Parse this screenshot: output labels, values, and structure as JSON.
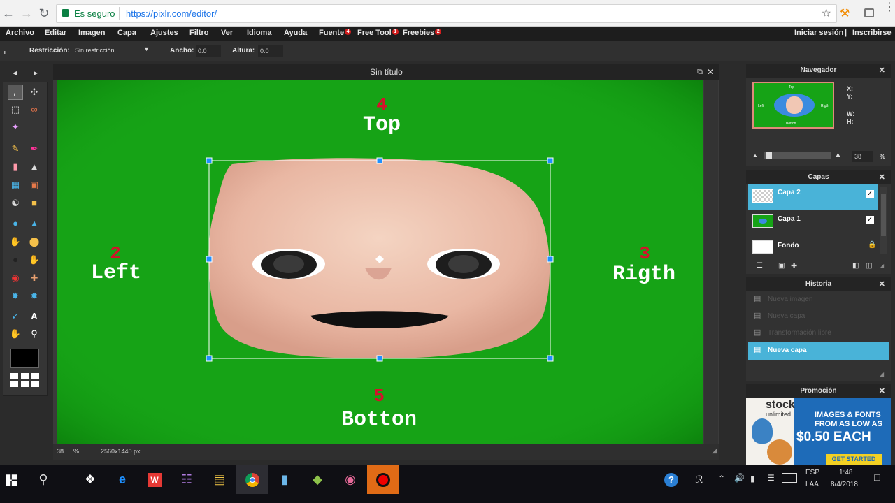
{
  "browser": {
    "secure_label": "Es seguro",
    "url": "https://pixlr.com/editor/"
  },
  "menu": {
    "items": [
      {
        "label": "Archivo"
      },
      {
        "label": "Editar"
      },
      {
        "label": "Imagen"
      },
      {
        "label": "Capa"
      },
      {
        "label": "Ajustes"
      },
      {
        "label": "Filtro"
      },
      {
        "label": "Ver"
      },
      {
        "label": "Idioma"
      },
      {
        "label": "Ayuda"
      },
      {
        "label": "Fuente",
        "badge": "4"
      },
      {
        "label": "Free Tool",
        "badge": "1"
      },
      {
        "label": "Freebies",
        "badge": "2"
      }
    ],
    "login": "Iniciar sesión",
    "separator": "|",
    "signup": "Inscribirse"
  },
  "options": {
    "restriction_label": "Restricción:",
    "restriction_value": "Sin restricción",
    "width_label": "Ancho:",
    "width_value": "0.0",
    "height_label": "Altura:",
    "height_value": "0.0"
  },
  "document": {
    "title": "Sin título",
    "zoom": "38",
    "zoom_unit": "%",
    "size": "2560x1440 px"
  },
  "canvas_labels": {
    "top_num": "4",
    "top": "Top",
    "left_num": "2",
    "left": "Left",
    "right_num": "3",
    "right": "Rigth",
    "bottom_num": "5",
    "bottom": "Botton"
  },
  "navigator": {
    "title": "Navegador",
    "x_label": "X:",
    "y_label": "Y:",
    "w_label": "W:",
    "h_label": "H:",
    "zoom": "38",
    "zoom_unit": "%",
    "thumb_top": "Top",
    "thumb_bottom": "Botton",
    "thumb_left": "Left",
    "thumb_right": "Rigth"
  },
  "layers": {
    "title": "Capas",
    "items": [
      {
        "name": "Capa 2",
        "checked": true,
        "selected": true
      },
      {
        "name": "Capa 1",
        "checked": true,
        "selected": false
      },
      {
        "name": "Fondo",
        "locked": true,
        "selected": false
      }
    ]
  },
  "history": {
    "title": "Historia",
    "items": [
      {
        "label": "Nueva imagen"
      },
      {
        "label": "Nueva capa"
      },
      {
        "label": "Transformación libre"
      },
      {
        "label": "Nueva capa",
        "selected": true
      }
    ]
  },
  "promo": {
    "title": "Promoción",
    "brand": "stock",
    "brand_sub": "unlimited",
    "line1": "IMAGES & FONTS",
    "line2": "FROM AS LOW AS",
    "price": "$0.50 EACH",
    "cta": "GET STARTED"
  },
  "taskbar": {
    "lang": "ESP",
    "lang_sub": "LAA",
    "time": "1:48",
    "date": "8/4/2018"
  },
  "colors": {
    "canvas_green": "#16a316",
    "label_red": "#d4122b",
    "selection_blue": "#49b3d8"
  }
}
